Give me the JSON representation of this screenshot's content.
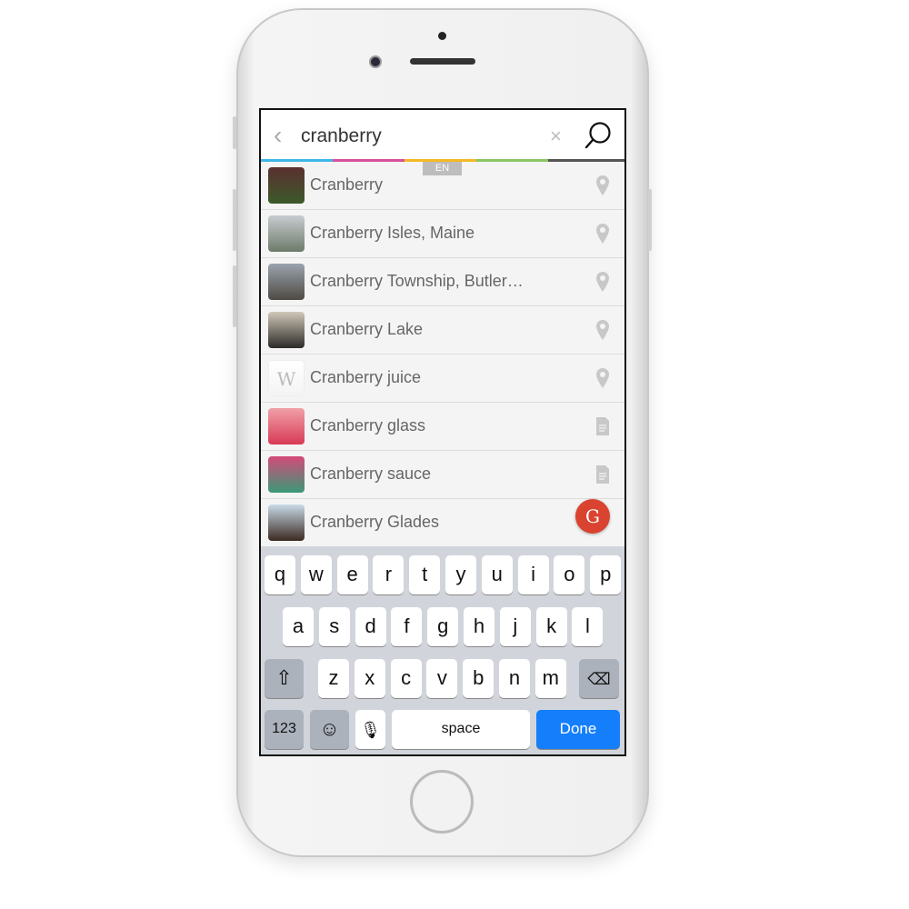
{
  "search": {
    "query": "cranberry",
    "language": "EN",
    "bar_colors": [
      "#3fb7e6",
      "#d6509b",
      "#f5b926",
      "#8cc564",
      "#555555"
    ]
  },
  "results": [
    {
      "label": "Cranberry",
      "icon": "map-pin-icon",
      "thumb": [
        "#5a3030",
        "#3c5a2a"
      ]
    },
    {
      "label": "Cranberry Isles, Maine",
      "icon": "map-pin-icon",
      "thumb": [
        "#c8ccd0",
        "#6d7a6a"
      ]
    },
    {
      "label": "Cranberry Township, Butler…",
      "icon": "map-pin-icon",
      "thumb": [
        "#9aa3ad",
        "#4e4a44"
      ]
    },
    {
      "label": "Cranberry Lake",
      "icon": "map-pin-icon",
      "thumb": [
        "#d0c8b8",
        "#2c2a28"
      ]
    },
    {
      "label": "Cranberry juice",
      "icon": "map-pin-icon",
      "thumb": [
        "#ffffff",
        "#f4f4f4"
      ],
      "thumb_text": "W"
    },
    {
      "label": "Cranberry glass",
      "icon": "document-icon",
      "thumb": [
        "#f0a0a8",
        "#d83a55"
      ]
    },
    {
      "label": "Cranberry sauce",
      "icon": "document-icon",
      "thumb": [
        "#d54a7a",
        "#3a9a78"
      ]
    },
    {
      "label": "Cranberry Glades",
      "icon": "",
      "thumb": [
        "#c9dbe8",
        "#3b2a22"
      ]
    }
  ],
  "fab_label": "G",
  "keyboard": {
    "row1": [
      "q",
      "w",
      "e",
      "r",
      "t",
      "y",
      "u",
      "i",
      "o",
      "p"
    ],
    "row2": [
      "a",
      "s",
      "d",
      "f",
      "g",
      "h",
      "j",
      "k",
      "l"
    ],
    "row3": [
      "z",
      "x",
      "c",
      "v",
      "b",
      "n",
      "m"
    ],
    "numbers": "123",
    "space": "space",
    "done": "Done"
  }
}
